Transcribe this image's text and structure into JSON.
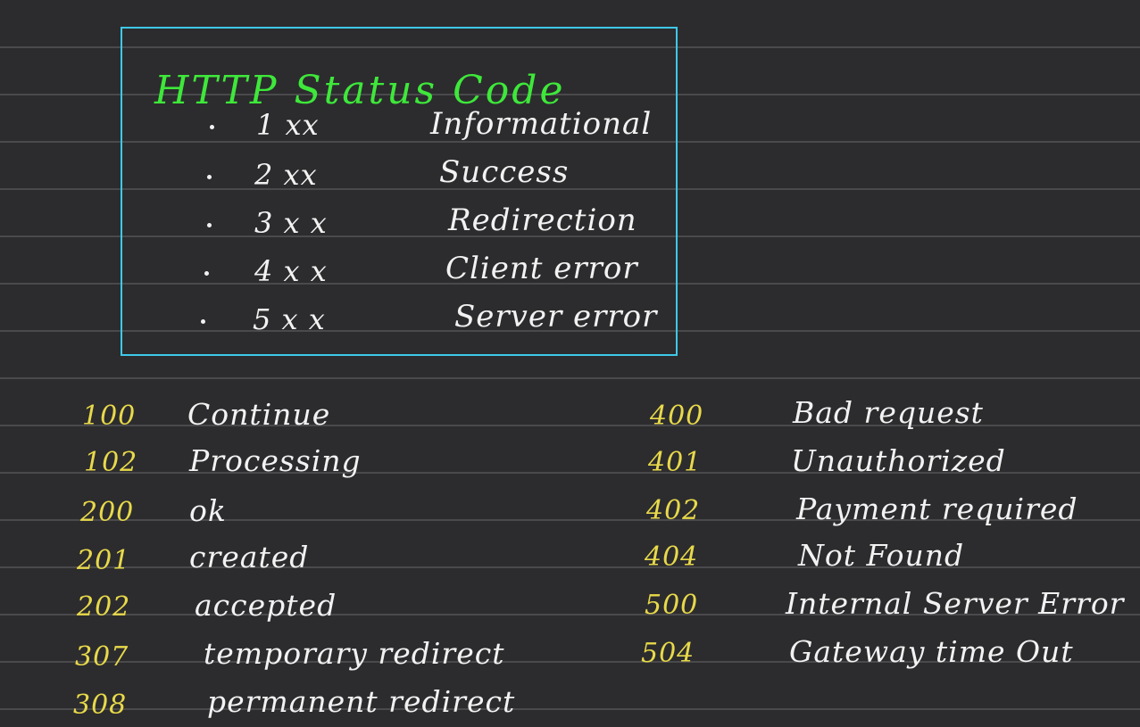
{
  "summary": {
    "title": "HTTP Status Code",
    "classes": [
      {
        "code": "1 xx",
        "label": "Informational"
      },
      {
        "code": "2 xx",
        "label": "Success"
      },
      {
        "code": "3 x x",
        "label": "Redirection"
      },
      {
        "code": "4 x x",
        "label": "Client error"
      },
      {
        "code": "5 x x",
        "label": "Server error"
      }
    ]
  },
  "left_list": [
    {
      "code": "100",
      "meaning": "Continue"
    },
    {
      "code": "102",
      "meaning": "Processing"
    },
    {
      "code": "200",
      "meaning": "ok"
    },
    {
      "code": "201",
      "meaning": "created"
    },
    {
      "code": "202",
      "meaning": "accepted"
    },
    {
      "code": "307",
      "meaning": "temporary redirect"
    },
    {
      "code": "308",
      "meaning": "permanent redirect"
    }
  ],
  "right_list": [
    {
      "code": "400",
      "meaning": "Bad request"
    },
    {
      "code": "401",
      "meaning": "Unauthorized"
    },
    {
      "code": "402",
      "meaning": "Payment required"
    },
    {
      "code": "404",
      "meaning": "Not Found"
    },
    {
      "code": "500",
      "meaning": "Internal Server Error"
    },
    {
      "code": "504",
      "meaning": "Gateway time Out"
    }
  ],
  "colors": {
    "background": "#2c2c2e",
    "rule_line": "#4a4a4d",
    "box_border": "#3ec9e8",
    "title": "#3ee83a",
    "code": "#e8d94a",
    "text": "#f2f2f2"
  }
}
